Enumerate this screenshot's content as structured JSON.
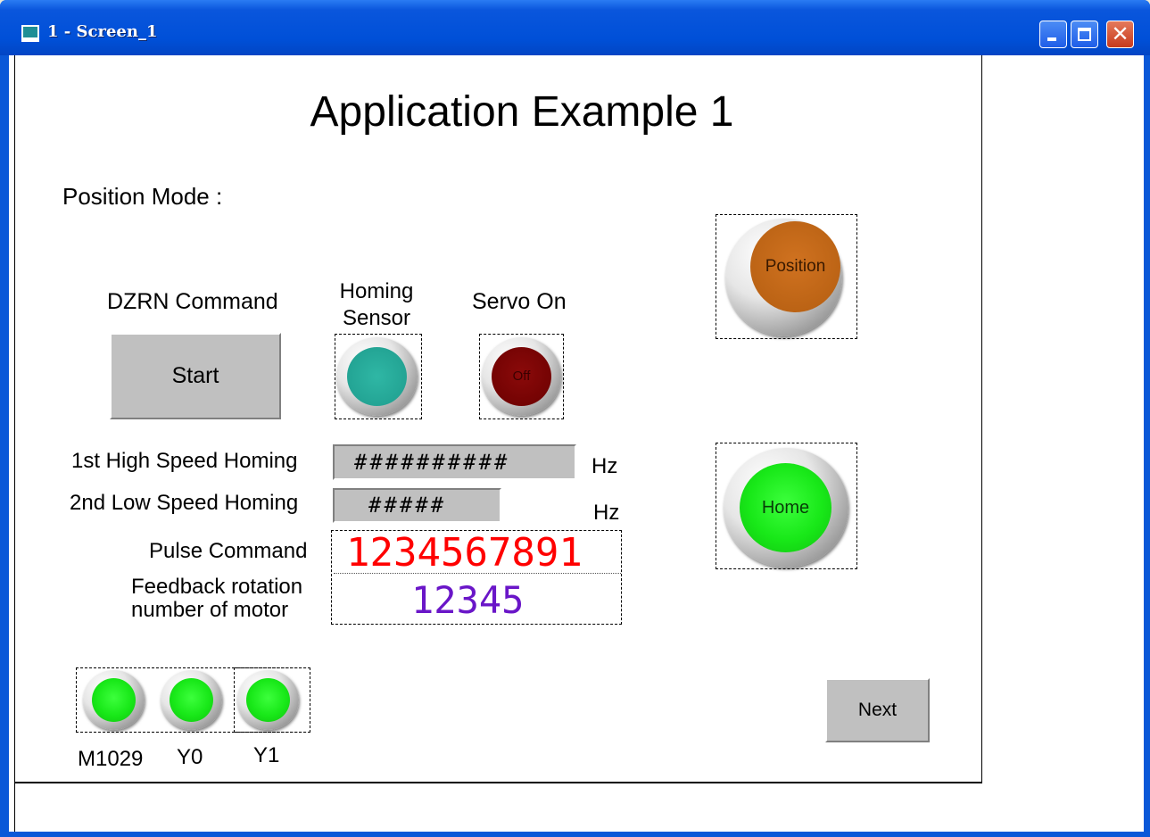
{
  "window": {
    "title": "1 - Screen_1",
    "close_glyph": "✕",
    "accent": "#0a58d8"
  },
  "screen": {
    "title": "Application Example 1",
    "mode_label": "Position Mode :",
    "dzrn_label": "DZRN Command",
    "start_button": "Start",
    "homing_sensor_label": "Homing Sensor",
    "servo_on_label": "Servo On",
    "servo_state_text": "Off",
    "position_button": "Position",
    "home_button": "Home",
    "high_speed_label": "1st High Speed Homing",
    "high_speed_value": "##########",
    "high_speed_unit": "Hz",
    "low_speed_label": "2nd Low Speed Homing",
    "low_speed_value": "#####",
    "low_speed_unit": "Hz",
    "pulse_label": "Pulse Command",
    "pulse_value": "1234567891",
    "feedback_label_line1": "Feedback rotation",
    "feedback_label_line2": "number of motor",
    "feedback_value": "12345",
    "next_button": "Next",
    "io_labels": [
      "M1029",
      "Y0",
      "Y1"
    ]
  },
  "colors": {
    "pulse_value": "#ff0000",
    "feedback_value": "#6a16c8",
    "homing_lamp": "#1e9c8d",
    "servo_lamp": "#7a0000",
    "green_lamp": "#18e818",
    "position_button": "#c0651a"
  }
}
